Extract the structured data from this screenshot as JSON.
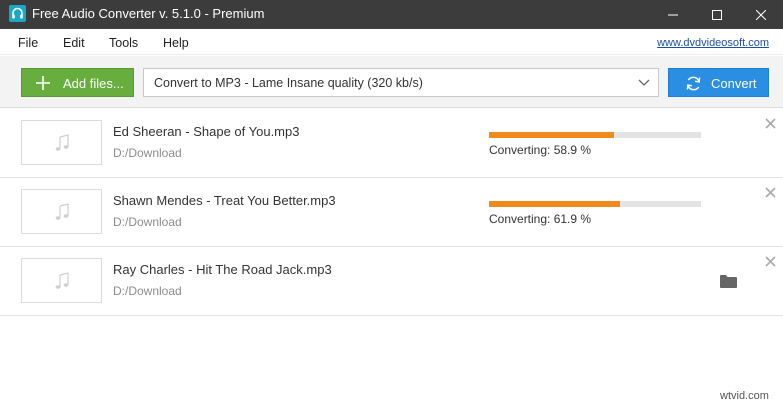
{
  "window": {
    "title": "Free Audio Converter v. 5.1.0 - Premium",
    "icon": "headphones-icon"
  },
  "menu": {
    "items": [
      "File",
      "Edit",
      "Tools",
      "Help"
    ],
    "site_link": "www.dvdvideosoft.com"
  },
  "toolbar": {
    "add_files_label": "Add files...",
    "format_value": "Convert to MP3 - Lame Insane quality (320 kb/s)",
    "convert_label": "Convert"
  },
  "files": [
    {
      "name": "Ed Sheeran - Shape of You.mp3",
      "path": "D:/Download",
      "progress": 0.589,
      "status": "Converting: 58.9 %"
    },
    {
      "name": "Shawn Mendes - Treat You Better.mp3",
      "path": "D:/Download",
      "progress": 0.619,
      "status": "Converting: 61.9 %"
    },
    {
      "name": "Ray Charles - Hit The Road Jack.mp3",
      "path": "D:/Download",
      "status": ""
    }
  ],
  "watermark": "wtvid.com",
  "colors": {
    "titlebar": "#3c3c3c",
    "add_button": "#68ae3f",
    "convert_button": "#2a8fe3",
    "progress": "#f08a1d",
    "link": "#1f4fa8"
  }
}
